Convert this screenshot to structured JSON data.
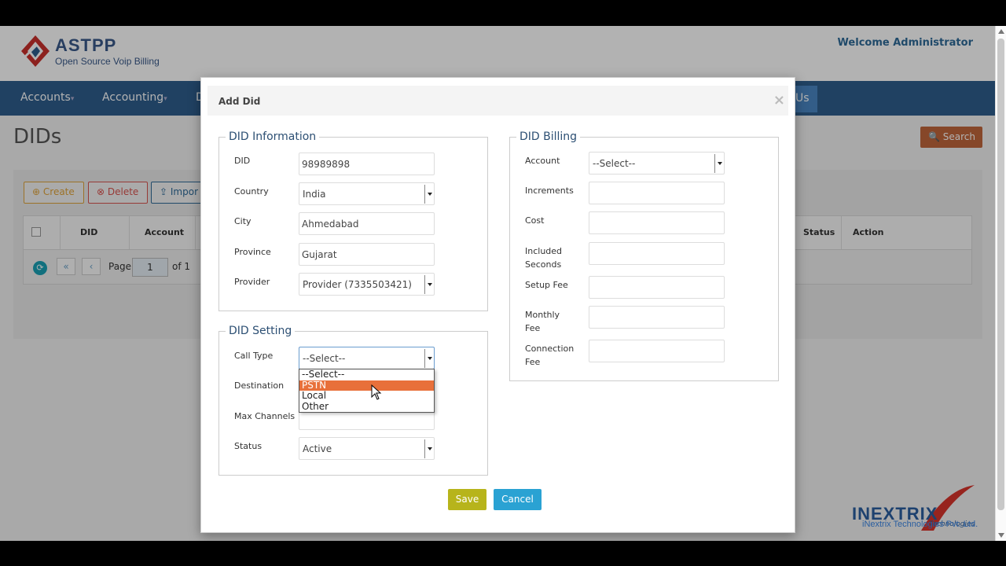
{
  "header": {
    "logo_title": "ASTPP",
    "logo_subtitle": "Open Source Voip Billing",
    "welcome": "Welcome Administrator"
  },
  "nav": {
    "items": [
      "Accounts",
      "Accounting",
      "D"
    ],
    "partial_right": "Us"
  },
  "page": {
    "title": "DIDs",
    "search_label": "Search"
  },
  "toolbar": {
    "create": "Create",
    "delete": "Delete",
    "import": "Impor"
  },
  "table": {
    "columns": [
      "DID",
      "Account",
      "Status",
      "Action"
    ],
    "pagination": {
      "page_label": "Page",
      "page_value": "1",
      "of_label": "of 1"
    }
  },
  "modal": {
    "title": "Add Did",
    "close": "×",
    "did_information": {
      "legend": "DID Information",
      "fields": [
        {
          "label": "DID",
          "value": "98989898",
          "kind": "input"
        },
        {
          "label": "Country",
          "value": "India",
          "kind": "select"
        },
        {
          "label": "City",
          "value": "Ahmedabad",
          "kind": "input"
        },
        {
          "label": "Province",
          "value": "Gujarat",
          "kind": "input"
        },
        {
          "label": "Provider",
          "value": "Provider (7335503421)",
          "kind": "select"
        }
      ]
    },
    "did_setting": {
      "legend": "DID Setting",
      "call_type_label": "Call Type",
      "call_type_value": "--Select--",
      "call_type_options": [
        "--Select--",
        "PSTN",
        "Local",
        "Other"
      ],
      "highlighted_option": "PSTN",
      "destination_label": "Destination",
      "max_channels_label": "Max Channels",
      "status_label": "Status",
      "status_value": "Active"
    },
    "did_billing": {
      "legend": "DID Billing",
      "account_label": "Account",
      "account_value": "--Select--",
      "increments_label": "Increments",
      "cost_label": "Cost",
      "included_seconds_label_1": "Included",
      "included_seconds_label_2": "Seconds",
      "setup_fee_label": "Setup Fee",
      "monthly_fee_label_1": "Monthly",
      "monthly_fee_label_2": "Fee",
      "connection_fee_label_1": "Connection",
      "connection_fee_label_2": "Fee"
    },
    "save": "Save",
    "cancel": "Cancel"
  },
  "brand": {
    "name": "INEXTRIX",
    "tagline": "Technologies",
    "company": "iNextrix Technologies Pvt. Ltd."
  },
  "colors": {
    "nav": "#2f5e8d",
    "accent_orange": "#e8703a",
    "save": "#b7b41b",
    "cancel": "#2aa2d3"
  }
}
